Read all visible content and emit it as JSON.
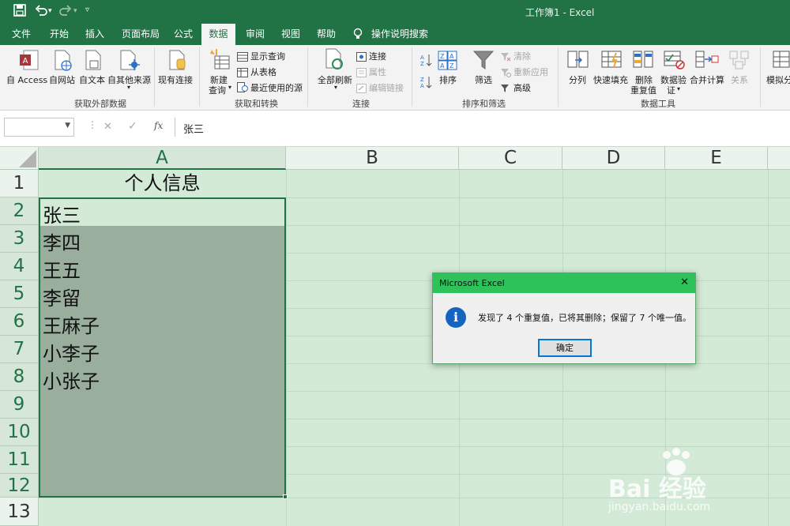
{
  "titlebar": {
    "title": "工作簿1  -  Excel",
    "quick_access": {
      "save_icon": "save-icon",
      "undo_icon": "undo-icon",
      "redo_icon": "redo-icon",
      "customize_icon": "customize-icon"
    }
  },
  "tabs": [
    "文件",
    "开始",
    "插入",
    "页面布局",
    "公式",
    "数据",
    "审阅",
    "视图",
    "帮助"
  ],
  "active_tab": "数据",
  "tell_me": "操作说明搜索",
  "ribbon": {
    "get_external": {
      "buttons": [
        "自 Access",
        "自网站",
        "自文本",
        "自其他来源",
        "现有连接"
      ],
      "label": "获取外部数据"
    },
    "get_transform": {
      "new_query": [
        "新建",
        "查询"
      ],
      "items": [
        "显示查询",
        "从表格",
        "最近使用的源"
      ],
      "label": "获取和转换"
    },
    "connections": {
      "refresh_all": "全部刷新",
      "items": [
        "连接",
        "属性",
        "编辑链接"
      ],
      "label": "连接"
    },
    "sort_filter": {
      "sort": "排序",
      "filter": "筛选",
      "items": [
        "清除",
        "重新应用",
        "高级"
      ],
      "label": "排序和筛选"
    },
    "data_tools": {
      "buttons": [
        "分列",
        "快速填充",
        "删除",
        "重复值",
        "数据验",
        "证",
        "合并计算",
        "关系"
      ],
      "label": "数据工具"
    },
    "forecast": {
      "what_if": "模拟分"
    }
  },
  "formula_bar": {
    "name_box": "",
    "cancel_glyph": "✕",
    "enter_glyph": "✓",
    "fx_label": "fx",
    "content": "张三"
  },
  "grid": {
    "columns": [
      "A",
      "B",
      "C",
      "D",
      "E"
    ],
    "rows": [
      "1",
      "2",
      "3",
      "4",
      "5",
      "6",
      "7",
      "8",
      "9",
      "10",
      "11",
      "12",
      "13"
    ],
    "header_cell": "个人信息",
    "values": [
      "张三",
      "李四",
      "王五",
      "李留",
      "王麻子",
      "小李子",
      "小张子"
    ]
  },
  "dialog": {
    "title": "Microsoft Excel",
    "close_glyph": "✕",
    "info_glyph": "i",
    "message": "发现了 4 个重复值，已将其删除；保留了 7 个唯一值。",
    "ok_label": "确定"
  },
  "watermark": {
    "brand": "Bai 经验",
    "url": "jingyan.baidu.com"
  },
  "colors": {
    "excel_green": "#217346",
    "dialog_title_bg": "#2ec25b",
    "sheet_bg": "#d3ead6",
    "selection": "#9aae9d"
  }
}
